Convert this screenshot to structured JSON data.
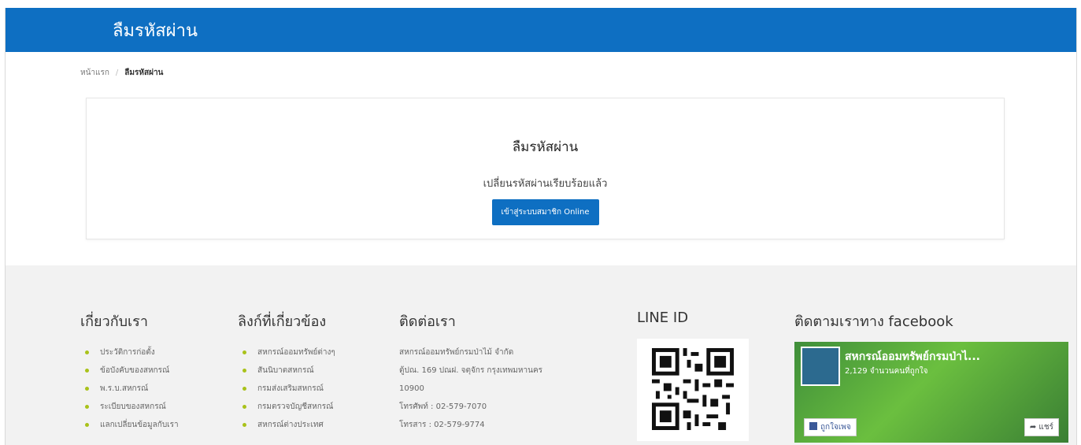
{
  "header": {
    "title": "ลืมรหัสผ่าน"
  },
  "breadcrumb": {
    "home": "หน้าแรก",
    "separator": "/",
    "current": "ลืมรหัสผ่าน"
  },
  "card": {
    "title": "ลืมรหัสผ่าน",
    "message": "เปลี่ยนรหัสผ่านเรียบร้อยแล้ว",
    "button_label": "เข้าสู่ระบบสมาชิก Online"
  },
  "footer": {
    "about": {
      "heading": "เกี่ยวกับเรา",
      "items": [
        "ประวัติการก่อตั้ง",
        "ข้อบังคับของสหกรณ์",
        "พ.ร.บ.สหกรณ์",
        "ระเบียบของสหกรณ์",
        "แลกเปลี่ยนข้อมูลกับเรา"
      ]
    },
    "links": {
      "heading": "ลิงก์ที่เกี่ยวข้อง",
      "items": [
        "สหกรณ์ออมทรัพย์ต่างๆ",
        "สันนิบาตสหกรณ์",
        "กรมส่งเสริมสหกรณ์",
        "กรมตรวจบัญชีสหกรณ์",
        "สหกรณ์ต่างประเทศ"
      ]
    },
    "contact": {
      "heading": "ติดต่อเรา",
      "lines": [
        "สหกรณ์ออมทรัพย์กรมป่าไม้ จำกัด",
        "ตู้ปณ. 169 ปณฝ. จตุจักร กรุงเทพมหานคร",
        "10900",
        "โทรศัพท์ : 02-579-7070",
        "โทรสาร : 02-579-9774"
      ]
    },
    "line": {
      "heading": "LINE ID"
    },
    "facebook": {
      "heading": "ติดตามเราทาง facebook",
      "page_name": "สหกรณ์ออมทรัพย์กรมป่าไ...",
      "likes": "2,129 จำนวนคนที่ถูกใจ",
      "like_label": "ถูกใจเพจ",
      "share_label": "แชร์"
    }
  },
  "colors": {
    "brand": "#0e6fc2",
    "bullet": "#a9c21a",
    "footer_bg": "#f2f2f2"
  }
}
